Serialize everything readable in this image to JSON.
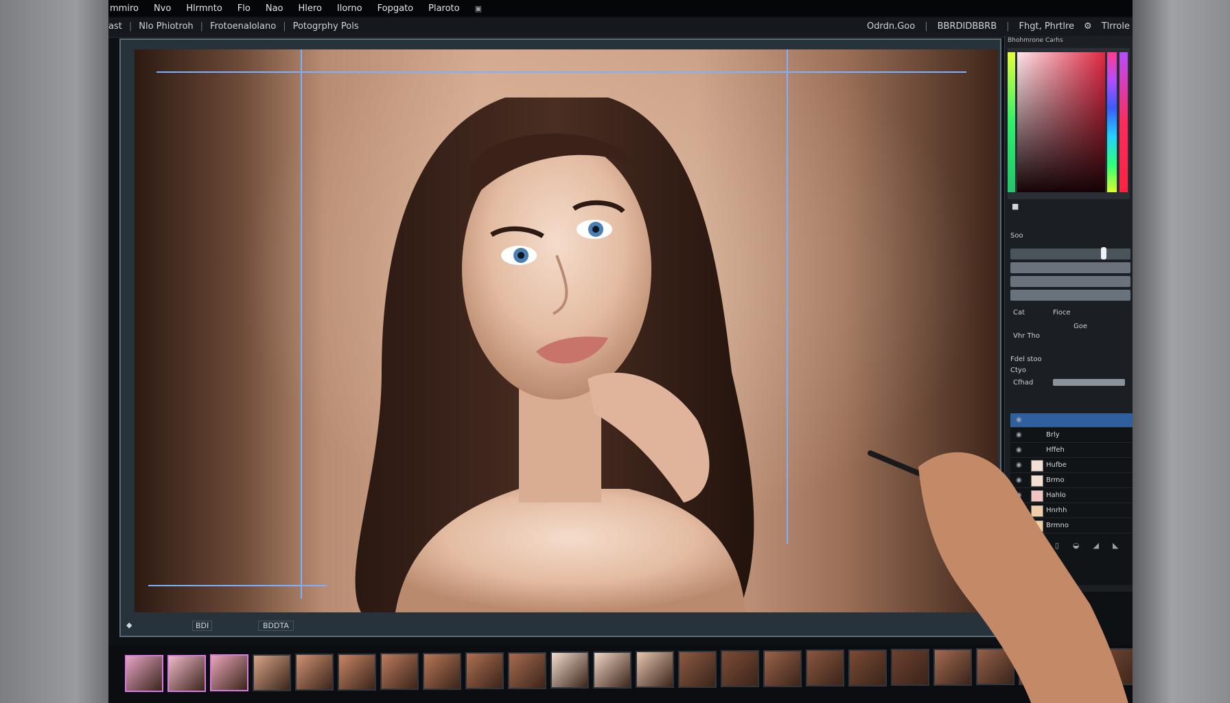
{
  "menubar": {
    "items": [
      "mmiro",
      "Nvo",
      "Hlrmnto",
      "Flo",
      "Nao",
      "Hlero",
      "Ilorno",
      "Fopgato",
      "Plaroto"
    ]
  },
  "optionsbar": {
    "left": [
      "ast",
      "Nlo Phiotroh",
      "Frotoenalolano",
      "Potogrphy Pols"
    ],
    "right": [
      "Odrdn.Goo",
      "BBRDIDBBRB",
      "Fhgt, Phrtlre",
      "Tlrrole"
    ]
  },
  "colors": {
    "accent": "#2f5f9c",
    "guide": "#7fb0ff",
    "panel": "#1b1f24"
  },
  "panel": {
    "title": "Bhohmrone Carhs",
    "controls": [
      "Soo",
      "Cat",
      "Fioce",
      "Goe",
      "Vhr Tho"
    ],
    "section": "Fdel stoo",
    "section_sub": "Ctyo",
    "section_label": "Cfhad"
  },
  "layers": {
    "items": [
      {
        "name": ""
      },
      {
        "name": "Brly"
      },
      {
        "name": "Hffeh"
      },
      {
        "name": "Hufbe"
      },
      {
        "name": "Brmo"
      },
      {
        "name": "Hahlo"
      },
      {
        "name": "Hnrhh"
      },
      {
        "name": "Brmno"
      }
    ]
  },
  "bottombar": {
    "label": "BDDTA",
    "buttons": [
      "BDI"
    ]
  },
  "filmstrip": {
    "count": 24
  }
}
